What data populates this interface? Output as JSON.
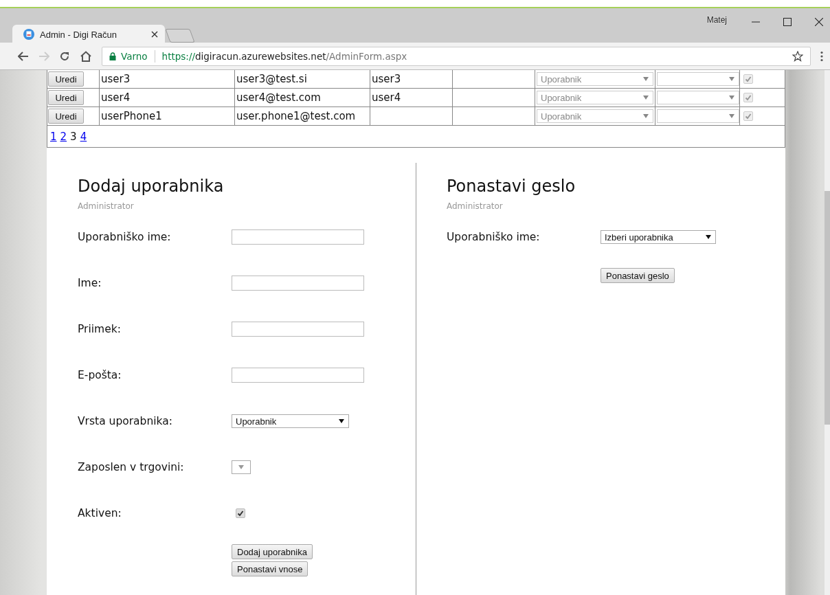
{
  "browser": {
    "tab_title": "Admin - Digi Račun",
    "user": "Matej",
    "security": "Varno",
    "url_scheme": "https://",
    "url_host": "digiracun.azurewebsites.net",
    "url_path": "/AdminForm.aspx"
  },
  "users_table": {
    "rows": [
      {
        "button": "Uredi",
        "username": "user3",
        "email": "user3@test.si",
        "column_4": "user3",
        "role": "Uporabnik",
        "active": true
      },
      {
        "button": "Uredi",
        "username": "user4",
        "email": "user4@test.com",
        "column_4": "user4",
        "role": "Uporabnik",
        "active": true
      },
      {
        "button": "Uredi",
        "username": "userPhone1",
        "email": "user.phone1@test.com",
        "role": "Uporabnik",
        "active": true
      }
    ],
    "pages": [
      {
        "label": "1",
        "selected": false
      },
      {
        "label": "2",
        "selected": false
      },
      {
        "label": "3",
        "selected": true
      },
      {
        "label": "4",
        "selected": false
      }
    ]
  },
  "add_user": {
    "title": "Dodaj uporabnika",
    "subtitle": "Administrator",
    "fields": [
      {
        "kind": "text",
        "label": "Uporabniško ime:"
      },
      {
        "kind": "text",
        "label": "Ime:"
      },
      {
        "kind": "text",
        "label": "Priimek:"
      },
      {
        "kind": "text",
        "label": "E-pošta:"
      },
      {
        "kind": "select",
        "label": "Vrsta uporabnika:",
        "value": "Uporabnik"
      },
      {
        "kind": "select",
        "label": "Zaposlen v trgovini:"
      },
      {
        "kind": "checkbox",
        "label": "Aktiven:",
        "checked": true
      }
    ],
    "buttons": [
      "Dodaj uporabnika",
      "Ponastavi vnose"
    ]
  },
  "reset_password": {
    "title": "Ponastavi geslo",
    "subtitle": "Administrator",
    "fields": [
      {
        "kind": "select",
        "label": "Uporabniško ime:",
        "value": "Izberi uporabnika"
      }
    ],
    "buttons": [
      "Ponastavi geslo"
    ]
  }
}
